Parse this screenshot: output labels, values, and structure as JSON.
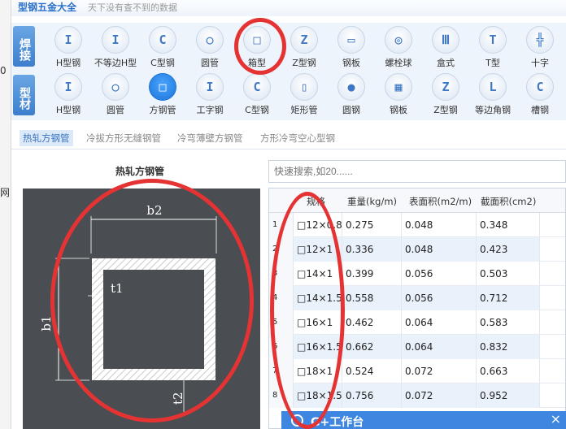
{
  "app": {
    "title": "型钢五金大全",
    "subtitle": "天下没有查不到的数据"
  },
  "background_strip": [
    "0",
    "网"
  ],
  "categories": [
    {
      "label": "焊接",
      "items": [
        {
          "label": "H型钢",
          "icon": "h-beam-icon",
          "glyph": "I"
        },
        {
          "label": "不等边H型",
          "icon": "unequal-h-icon",
          "glyph": "I"
        },
        {
          "label": "C型钢",
          "icon": "c-channel-icon",
          "glyph": "C"
        },
        {
          "label": "圆管",
          "icon": "round-tube-icon",
          "glyph": "○"
        },
        {
          "label": "箱型",
          "icon": "box-section-icon",
          "glyph": "□"
        },
        {
          "label": "Z型钢",
          "icon": "z-section-icon",
          "glyph": "Z"
        },
        {
          "label": "钢板",
          "icon": "plate-icon",
          "glyph": "▭"
        },
        {
          "label": "螺栓球",
          "icon": "bolt-ball-icon",
          "glyph": "◎"
        },
        {
          "label": "盒式",
          "icon": "box-type-icon",
          "glyph": "Ⅲ"
        },
        {
          "label": "T型",
          "icon": "t-section-icon",
          "glyph": "T"
        },
        {
          "label": "十字",
          "icon": "cross-section-icon",
          "glyph": "╬"
        }
      ]
    },
    {
      "label": "型材",
      "items": [
        {
          "label": "H型钢",
          "icon": "h-beam-icon",
          "glyph": "I"
        },
        {
          "label": "圆管",
          "icon": "round-tube-icon",
          "glyph": "○"
        },
        {
          "label": "方钢管",
          "icon": "square-tube-icon",
          "glyph": "□",
          "active": true
        },
        {
          "label": "工字钢",
          "icon": "i-beam-icon",
          "glyph": "I"
        },
        {
          "label": "C型钢",
          "icon": "c-channel-icon",
          "glyph": "C"
        },
        {
          "label": "矩形管",
          "icon": "rect-tube-icon",
          "glyph": "▯"
        },
        {
          "label": "圆钢",
          "icon": "round-bar-icon",
          "glyph": "●"
        },
        {
          "label": "钢板",
          "icon": "plate-icon",
          "glyph": "▦"
        },
        {
          "label": "Z型钢",
          "icon": "z-section-icon",
          "glyph": "Z"
        },
        {
          "label": "等边角钢",
          "icon": "angle-icon",
          "glyph": "L"
        },
        {
          "label": "槽钢",
          "icon": "channel-icon",
          "glyph": "C"
        }
      ]
    }
  ],
  "subtabs": [
    {
      "label": "热轧方钢管",
      "active": true
    },
    {
      "label": "冷拔方形无缝钢管"
    },
    {
      "label": "冷弯薄壁方钢管"
    },
    {
      "label": "方形冷弯空心型钢"
    }
  ],
  "diagram": {
    "title": "热轧方钢管",
    "labels": {
      "b2": "b2",
      "t1": "t1",
      "b1": "b1",
      "t2": "t2"
    }
  },
  "search": {
    "placeholder": "快速搜索,如20......"
  },
  "table": {
    "headers": [
      "",
      "规格",
      "重量(kg/m)",
      "表面积(m2/m)",
      "截面积(cm2)"
    ],
    "rows": [
      [
        "1",
        "□12×0.8",
        "0.275",
        "0.048",
        "0.348"
      ],
      [
        "2",
        "□12×1",
        "0.336",
        "0.048",
        "0.423"
      ],
      [
        "3",
        "□14×1",
        "0.399",
        "0.056",
        "0.503"
      ],
      [
        "4",
        "□14×1.5",
        "0.558",
        "0.056",
        "0.712"
      ],
      [
        "5",
        "□16×1",
        "0.462",
        "0.064",
        "0.583"
      ],
      [
        "6",
        "□16×1.5",
        "0.662",
        "0.064",
        "0.832"
      ],
      [
        "7",
        "□18×1",
        "0.524",
        "0.072",
        "0.663"
      ],
      [
        "8",
        "□18×1.5",
        "0.756",
        "0.072",
        "0.952"
      ]
    ]
  },
  "popup": {
    "title": "G+工作台",
    "close": "×"
  }
}
